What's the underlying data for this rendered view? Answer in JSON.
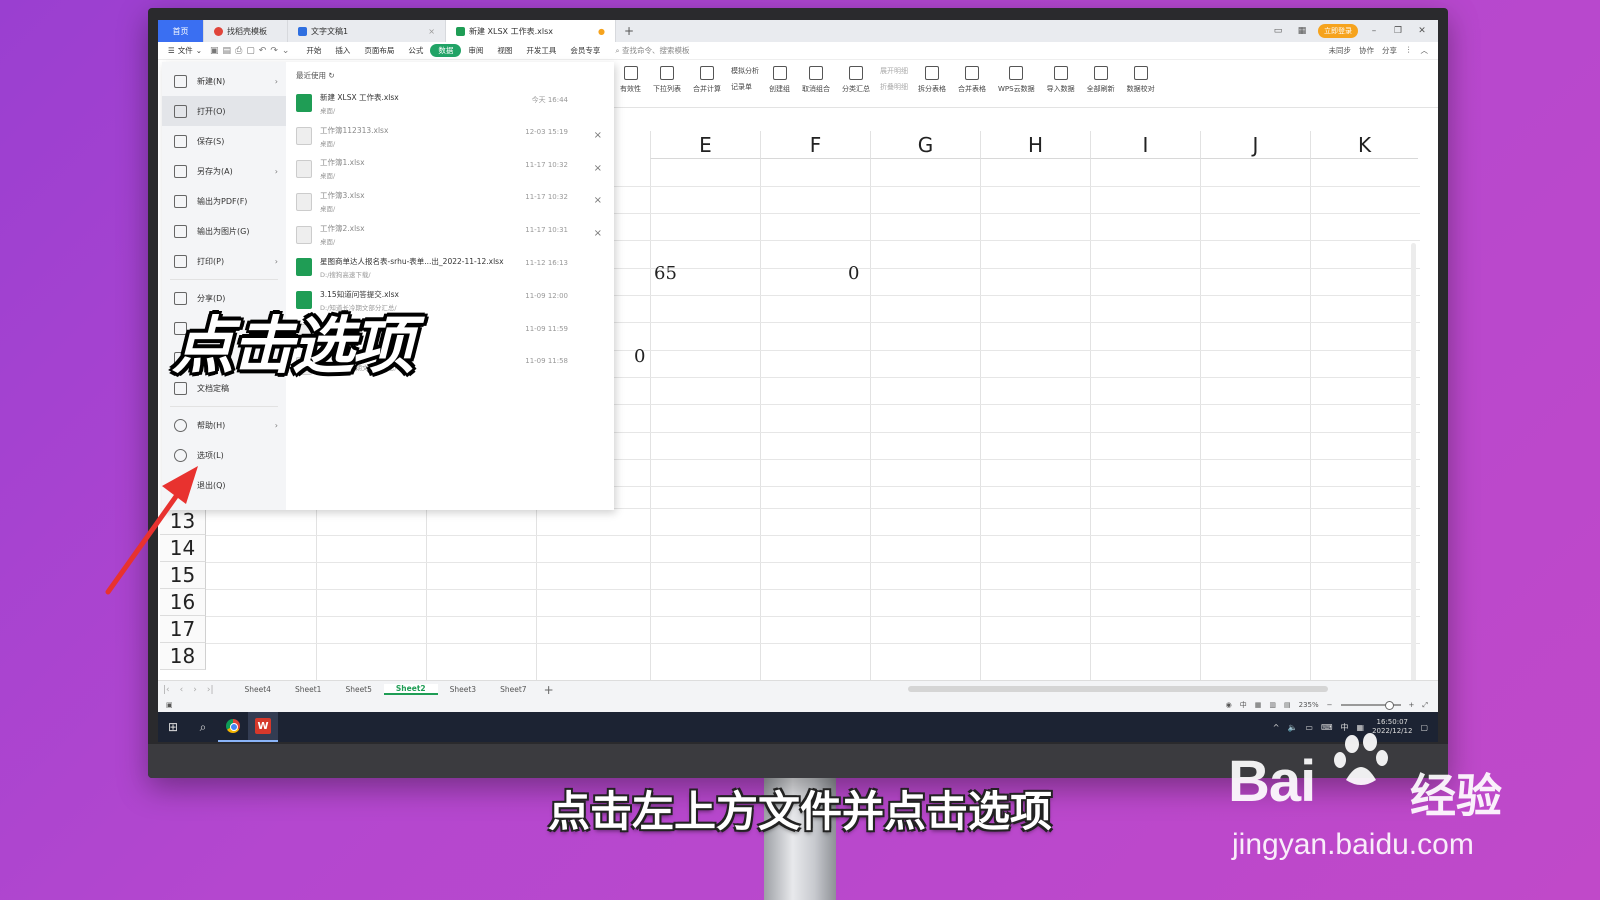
{
  "tabs": {
    "home": "首页",
    "t1": "找稻壳模板",
    "t2": "文字文稿1",
    "t3": "新建 XLSX 工作表.xlsx",
    "login": "立即登录"
  },
  "menu": {
    "file": "文件",
    "items": [
      "开始",
      "插入",
      "页面布局",
      "公式",
      "数据",
      "审阅",
      "视图",
      "开发工具",
      "会员专享"
    ],
    "search": "查找命令、搜索模板",
    "right": [
      "未同步",
      "协作",
      "分享"
    ]
  },
  "ribbon": {
    "validity": "有效性",
    "dropdown": "下拉列表",
    "merge_calc": "合并计算",
    "sim_analysis": "模拟分析",
    "record": "记录单",
    "create_group": "创建组",
    "ungroup": "取消组合",
    "subtotal": "分类汇总",
    "expand": "展开明细",
    "collapse": "折叠明细",
    "split_table": "拆分表格",
    "merge_table": "合并表格",
    "wps_cloud": "WPS云数据",
    "import": "导入数据",
    "refresh_all": "全部刷新",
    "data_check": "数据校对"
  },
  "columns": [
    "E",
    "F",
    "G",
    "H",
    "I",
    "J",
    "K"
  ],
  "rows": [
    "13",
    "14",
    "15",
    "16",
    "17",
    "18"
  ],
  "cells": {
    "e_row": "65",
    "f_row": "0",
    "d_row": "0"
  },
  "filemenu": {
    "new": "新建(N)",
    "open": "打开(O)",
    "save": "保存(S)",
    "saveas": "另存为(A)",
    "pdf": "输出为PDF(F)",
    "image": "输出为图片(G)",
    "print": "打印(P)",
    "share": "分享(D)",
    "doc_encrypt": "文档定稿",
    "help": "帮助(H)",
    "options": "选项(L)",
    "exit": "退出(Q)",
    "recent_title": "最近使用",
    "recent": [
      {
        "name": "新建 XLSX 工作表.xlsx",
        "path": "桌面/",
        "time": "今天 16:44"
      },
      {
        "name": "工作簿112313.xlsx",
        "path": "桌面/",
        "time": "12-03 15:19"
      },
      {
        "name": "工作簿1.xlsx",
        "path": "桌面/",
        "time": "11-17 10:32"
      },
      {
        "name": "工作簿3.xlsx",
        "path": "桌面/",
        "time": "11-17 10:32"
      },
      {
        "name": "工作簿2.xlsx",
        "path": "桌面/",
        "time": "11-17 10:31"
      },
      {
        "name": "星图商单达人报名表-srhu-表单...出_2022-11-12.xlsx",
        "path": "D:/搜狗高速下载/",
        "time": "11-12 16:13"
      },
      {
        "name": "3.15知道问答提交.xlsx",
        "path": "D:/知道长冷期文部分汇总/",
        "time": "11-09 12:00"
      },
      {
        "name": "",
        "path": "",
        "time": "11-09 11:59"
      },
      {
        "name": "",
        "path": "D:/知道长冷期文部分汇总/",
        "time": "11-09 11:58"
      }
    ]
  },
  "sheets": [
    "Sheet4",
    "Sheet1",
    "Sheet5",
    "Sheet2",
    "Sheet3",
    "Sheet7"
  ],
  "active_sheet": "Sheet2",
  "status": {
    "zoom": "235%"
  },
  "taskbar": {
    "time": "16:50:07",
    "date": "2022/12/12",
    "ime": "中"
  },
  "overlay": {
    "big": "点击选项",
    "caption": "点击左上方文件并点击选项",
    "watermark_cn": "经验",
    "watermark_url": "jingyan.baidu.com"
  }
}
